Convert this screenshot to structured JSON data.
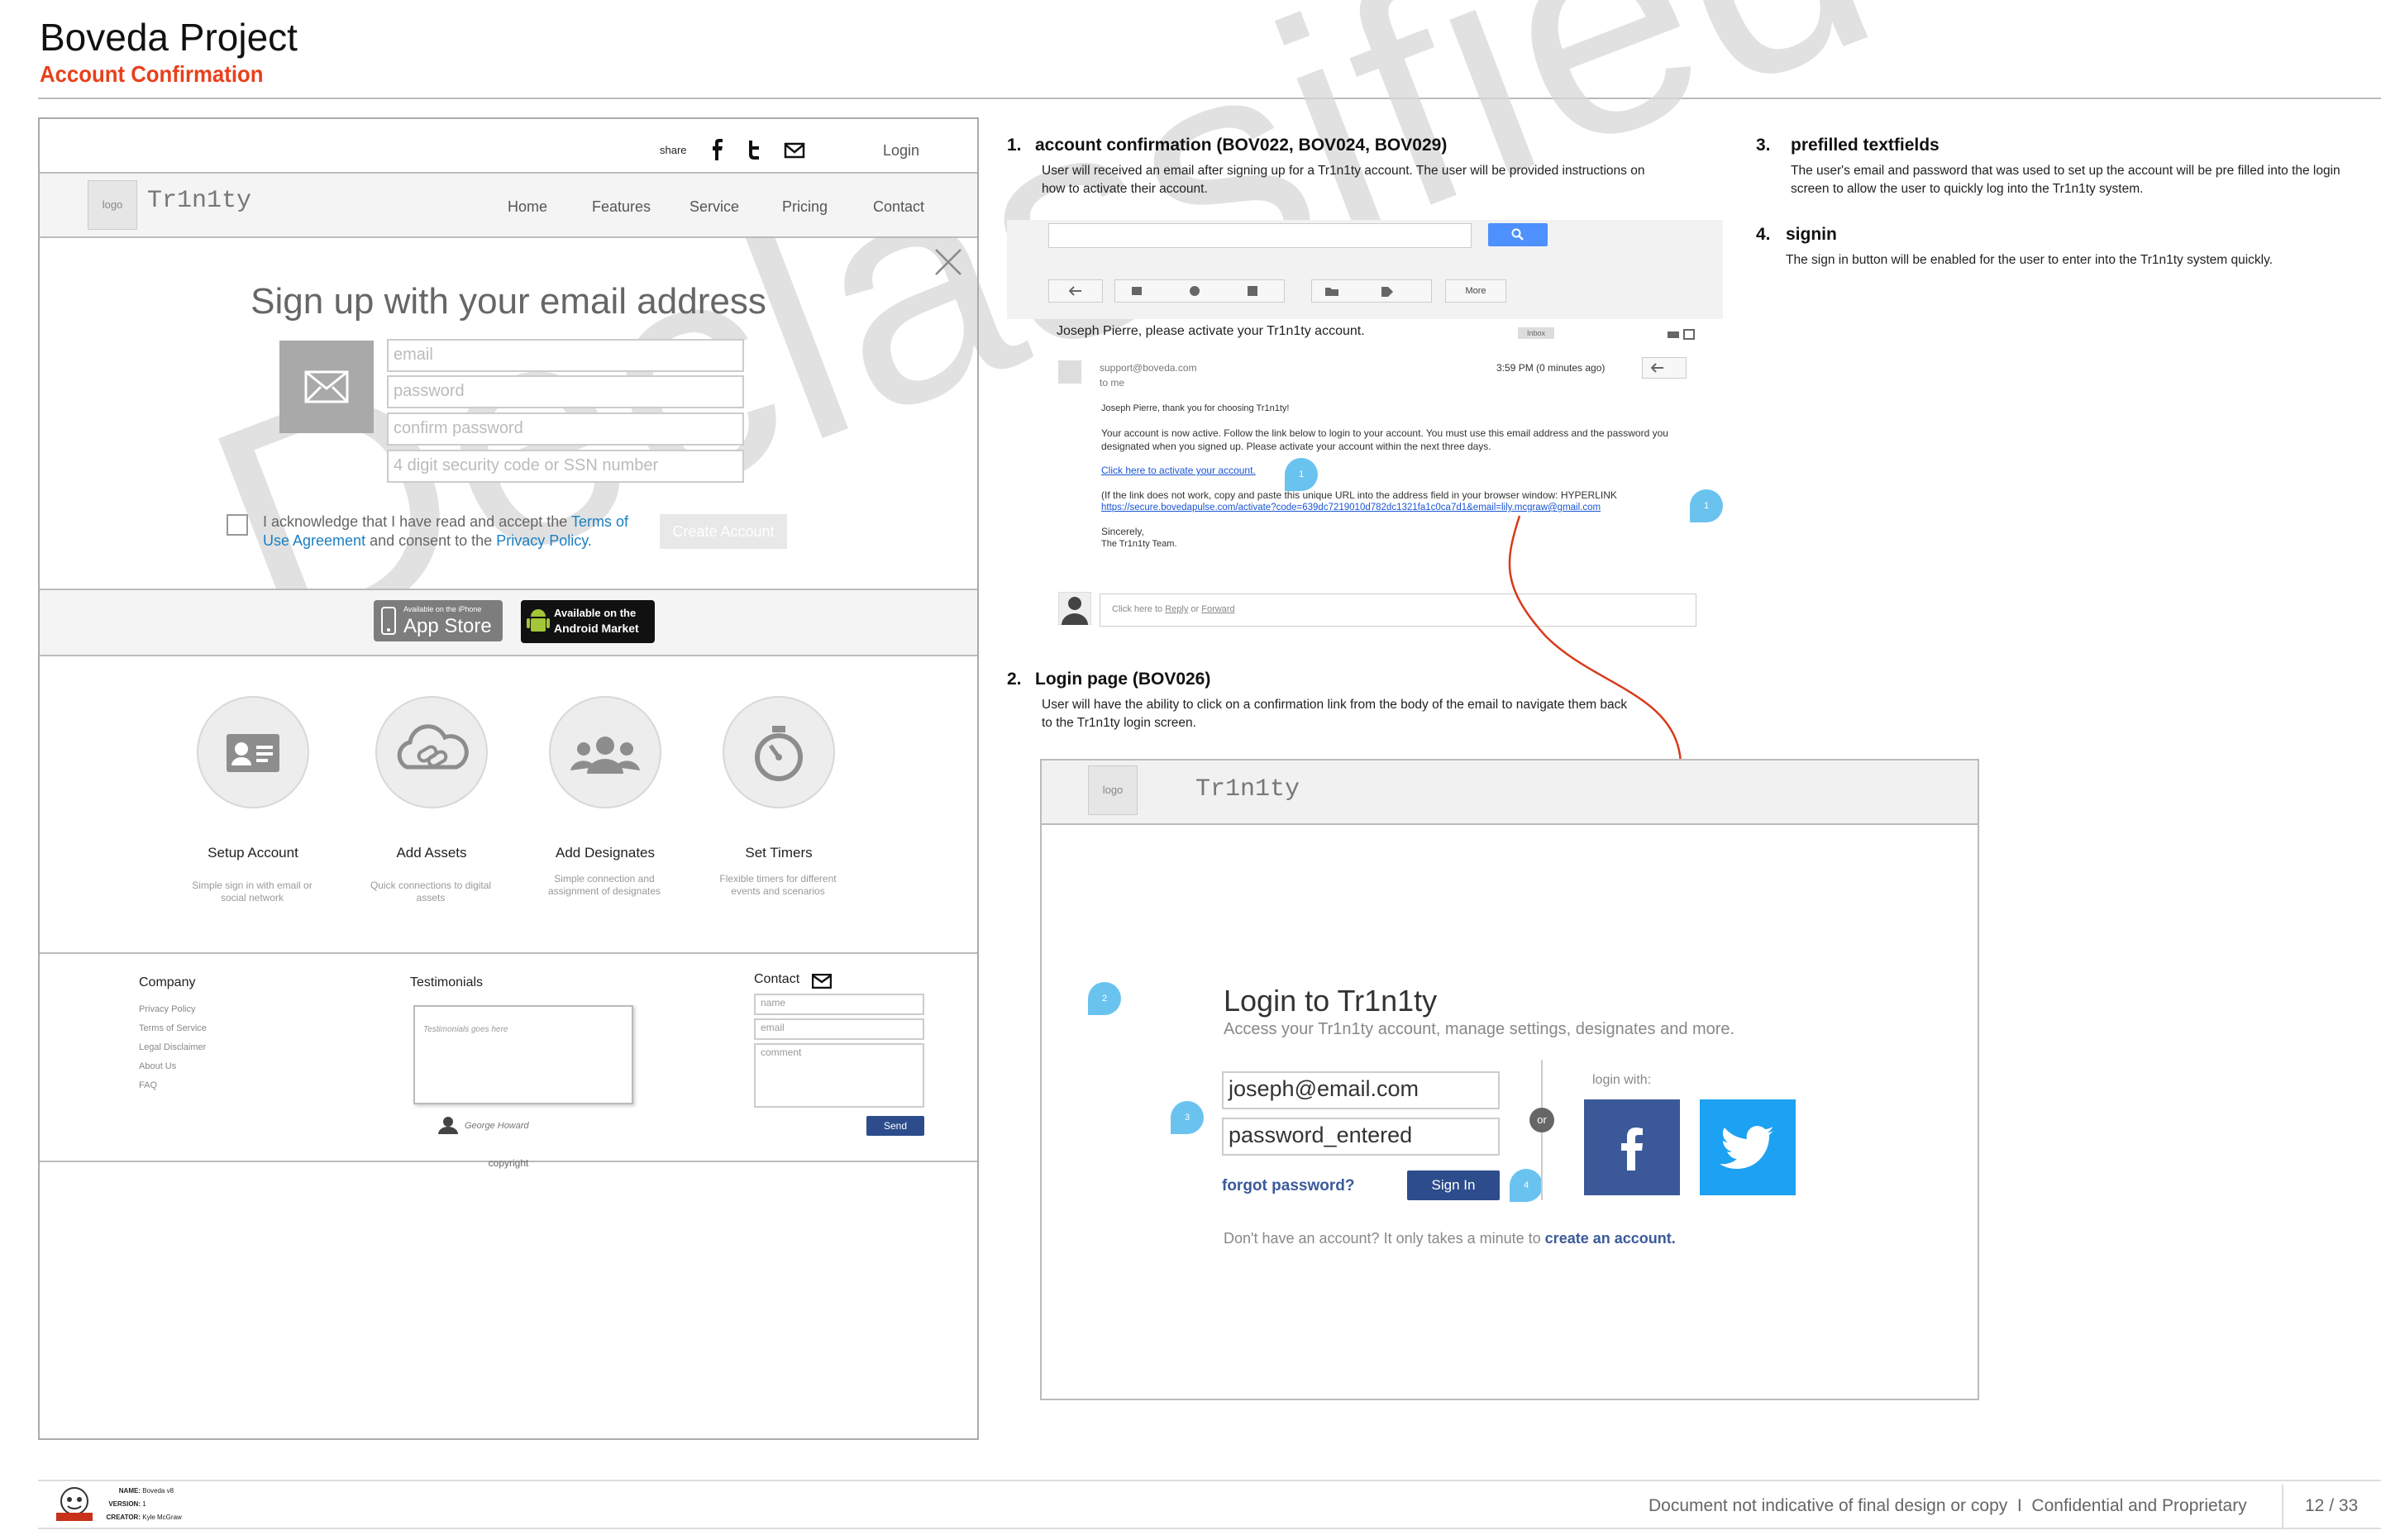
{
  "header": {
    "title": "Boveda Project",
    "subtitle": "Account Confirmation"
  },
  "wireframe": {
    "top": {
      "share": "share",
      "login": "Login"
    },
    "nav": {
      "logo": "logo",
      "brand": "Tr1n1ty",
      "links": [
        "Home",
        "Features",
        "Service",
        "Pricing",
        "Contact"
      ]
    },
    "signup": {
      "title": "Sign up with your email address",
      "fields": [
        "email",
        "password",
        "confirm password",
        "4 digit security code or SSN number"
      ],
      "ack_prefix": "I acknowledge that I have read and accept the ",
      "ack_link1": "Terms of Use Agreement",
      "ack_mid": " and consent to the ",
      "ack_link2": "Privacy Policy.",
      "create": "Create Account"
    },
    "stores": {
      "appstore_small": "Available on the iPhone",
      "appstore_big": "App Store",
      "android_small": "Available on the",
      "android_big": "Android Market"
    },
    "features": [
      {
        "title": "Setup Account",
        "desc": "Simple sign in with email or social network",
        "icon": "id-card-icon"
      },
      {
        "title": "Add Assets",
        "desc": "Quick connections to digital assets",
        "icon": "cloud-link-icon"
      },
      {
        "title": "Add Designates",
        "desc": "Simple connection and assignment of designates",
        "icon": "people-icon"
      },
      {
        "title": "Set Timers",
        "desc": "Flexible timers for different events and scenarios",
        "icon": "stopwatch-icon"
      }
    ],
    "footer": {
      "company": "Company",
      "company_links": [
        "Privacy Policy",
        "Terms of Service",
        "Legal Disclaimer",
        "About Us",
        "FAQ"
      ],
      "testimonials": "Testimonials",
      "testimonial_text": "Testimonials goes here",
      "testimonial_author": "George Howard",
      "contact": "Contact",
      "contact_fields": [
        "name",
        "email",
        "comment"
      ],
      "send": "Send",
      "copyright": "copyright"
    }
  },
  "sections": [
    {
      "num": "1.",
      "title": "account confirmation (BOV022, BOV024, BOV029)",
      "desc": "User will received an email after signing up for a Tr1n1ty account.  The user will be provided instructions on how to activate their account."
    },
    {
      "num": "2.",
      "title": "Login page (BOV026)",
      "desc": "User will have the ability to click on a confirmation link from the body of the email to navigate them back to the Tr1n1ty login screen."
    },
    {
      "num": "3.",
      "title": "prefilled textfields",
      "desc": "The user's email and password that was used to set up the account will be pre filled into the login screen to allow the user to quickly log into the Tr1n1ty system."
    },
    {
      "num": "4.",
      "title": "signin",
      "desc": "The sign in button will be enabled for the user to enter into the Tr1n1ty system quickly."
    }
  ],
  "email": {
    "more": "More",
    "subject": "Joseph Pierre, please activate your Tr1n1ty account.",
    "inbox_tag": "Inbox",
    "from": "support@boveda.com",
    "to": "to me",
    "time": "3:59 PM (0 minutes ago)",
    "greeting": "Joseph Pierre, thank you for choosing Tr1n1ty!",
    "body1": "Your account is now active. Follow the link below to login to your account. You must use this email address and the password you designated when you signed up. Please activate your account within the next three days.",
    "link1": "Click here to activate your account.",
    "body2": "(If the link does not work, copy and paste this unique URL into the address field in your browser window: HYPERLINK",
    "link2": "https://secure.bovedapulse.com/activate?code=639dc7219010d782dc1321fa1c0ca7d1&email=lily.mcgraw@gmail.com",
    "sign1": "Sincerely,",
    "sign2": "The Tr1n1ty Team.",
    "reply_prefix": "Click here to ",
    "reply": "Reply",
    "reply_or": " or ",
    "forward": "Forward",
    "bubble1": "1",
    "bubble2": "1"
  },
  "login": {
    "logo": "logo",
    "brand": "Tr1n1ty",
    "title": "Login to Tr1n1ty",
    "subtitle": "Access your Tr1n1ty account, manage settings, designates and more.",
    "email": "joseph@email.com",
    "password": "password_entered",
    "forgot": "forgot password?",
    "signin": "Sign In",
    "or": "or",
    "login_with": "login with:",
    "noacc": "Don't have an account? It only takes a minute to ",
    "create": "create an account.",
    "bubble2": "2",
    "bubble3": "3",
    "bubble4": "4"
  },
  "watermark": "Declassified",
  "footer": {
    "name_label": "NAME:",
    "name": "Boveda v8",
    "version_label": "VERSION:",
    "version": "1",
    "creator_label": "CREATOR:",
    "creator": "Kyle McGraw",
    "disclaimer": "Document not indicative of final design or copy  I  Confidential and Proprietary",
    "page": "12 / 33"
  },
  "colors": {
    "accent": "#e8401c",
    "link": "#1a7fc4",
    "bubble": "#6ac3ef",
    "facebook": "#3b5998",
    "twitter": "#1da1f2",
    "navy": "#2d4c8c"
  }
}
